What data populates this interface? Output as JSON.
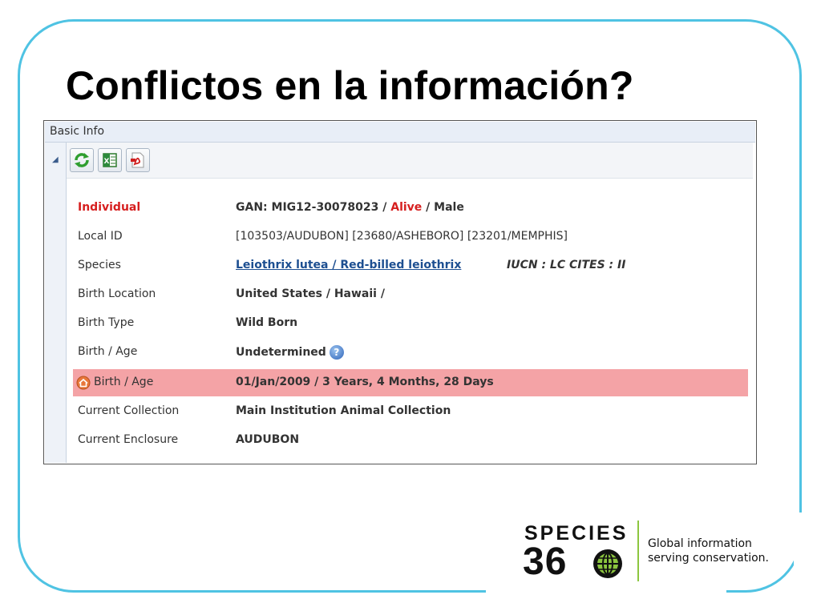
{
  "slide": {
    "title": "Conflictos en la información?"
  },
  "panel": {
    "title": "Basic Info",
    "toolbar": [
      {
        "name": "refresh-icon"
      },
      {
        "name": "excel-export-icon"
      },
      {
        "name": "pdf-export-icon"
      }
    ]
  },
  "rows": {
    "individual": {
      "label": "Individual",
      "gan": "GAN: MIG12-30078023 / ",
      "status": "Alive",
      "sex": " / Male"
    },
    "local_id": {
      "label": "Local ID",
      "value": "[103503/AUDUBON] [23680/ASHEBORO] [23201/MEMPHIS]"
    },
    "species": {
      "label": "Species",
      "value": "Leiothrix lutea / Red-billed leiothrix",
      "iucn": "IUCN : LC   CITES : II"
    },
    "birth_location": {
      "label": "Birth Location",
      "value": "United States / Hawaii /"
    },
    "birth_type": {
      "label": "Birth Type",
      "value": "Wild Born"
    },
    "birth_age_1": {
      "label": "Birth / Age",
      "value": "Undetermined"
    },
    "birth_age_2": {
      "label": "Birth / Age",
      "value": "01/Jan/2009 / 3 Years, 4 Months, 28 Days"
    },
    "current_collection": {
      "label": "Current Collection",
      "value": "Main Institution Animal Collection"
    },
    "current_enclosure": {
      "label": "Current Enclosure",
      "value": "AUDUBON"
    }
  },
  "logo": {
    "word": "SPECIES",
    "number": "36",
    "tagline_1": "Global information",
    "tagline_2": "serving conservation."
  },
  "colors": {
    "frame": "#4fc3e3",
    "highlight_row": "#f4a3a6",
    "alert_red": "#d61f1f",
    "link_blue": "#1d4f91",
    "logo_green": "#8cc63f"
  }
}
